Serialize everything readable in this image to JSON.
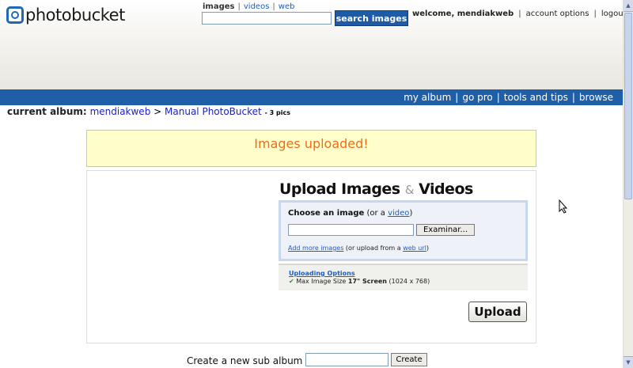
{
  "header": {
    "logo": {
      "icon": "camera-icon",
      "text": "photobucket"
    },
    "search": {
      "tabs": [
        "images",
        "videos",
        "web"
      ],
      "active_tab": "images",
      "query": "",
      "button_label": "search images"
    },
    "user": {
      "welcome": "welcome, mendiakweb",
      "links": [
        "account options",
        "logout"
      ]
    }
  },
  "nav": {
    "items": [
      "my album",
      "go pro",
      "tools and tips",
      "browse"
    ],
    "color": "#1f5fa8"
  },
  "album": {
    "label": "current album:",
    "path": [
      "mendiakweb",
      "Manual PhotoBucket"
    ],
    "separator": ">",
    "count": "- 3 pics"
  },
  "notice": {
    "text": "Images uploaded!",
    "color": "#f06b16"
  },
  "upload": {
    "title_part1": "Upload Images",
    "amp": "&",
    "title_part2": "Videos",
    "choose_label": "Choose an image",
    "choose_alt_prefix": " (or a ",
    "choose_alt_link": "video",
    "choose_alt_suffix": ")",
    "file_value": "",
    "browse_label": "Examinar...",
    "more_link": "Add more images",
    "more_middle": " (or upload from a ",
    "web_url_link": "web url",
    "more_suffix": ")",
    "options_title": "Uploading Options",
    "options_prefix": "Max Image Size ",
    "options_bold": "17\" Screen",
    "options_suffix": " (1024 x 768)",
    "upload_button": "Upload"
  },
  "sub_album": {
    "label": "Create a new sub album",
    "value": "",
    "button_label": "Create"
  }
}
